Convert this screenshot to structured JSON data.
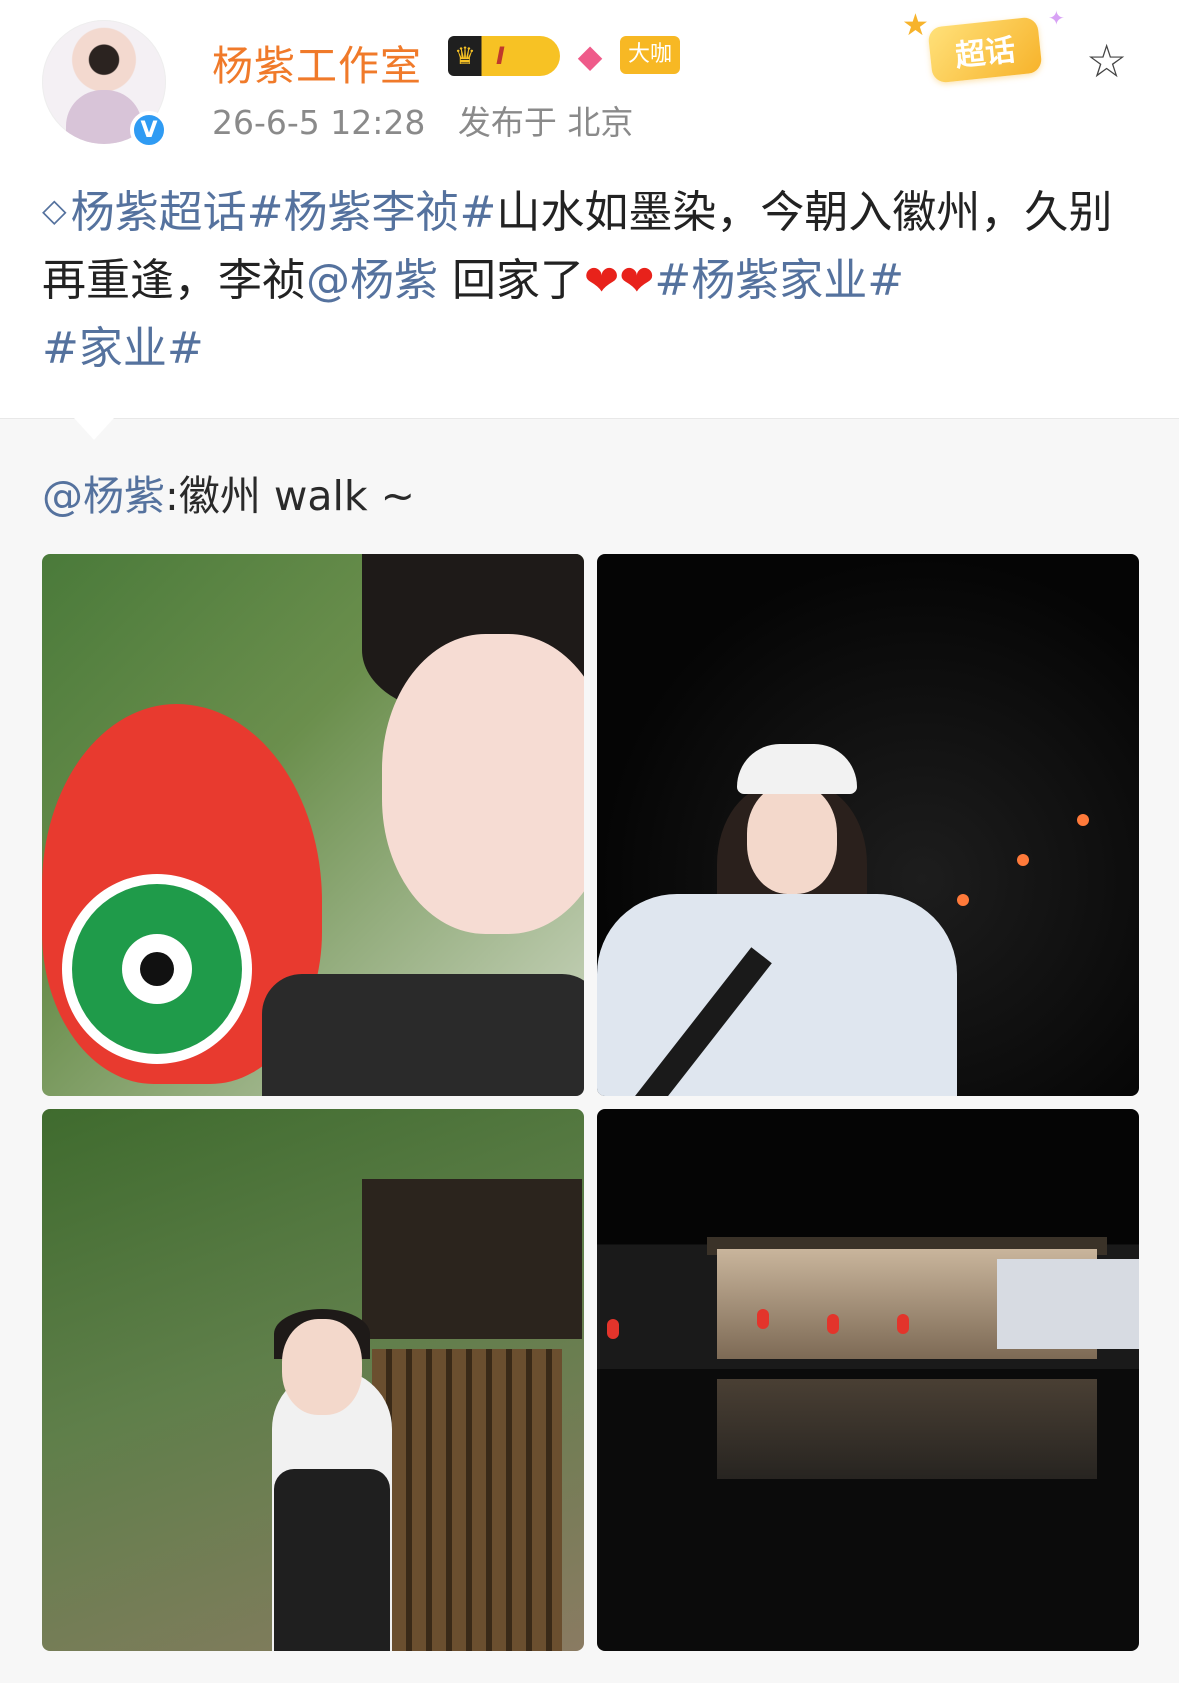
{
  "header": {
    "username": "杨紫工作室",
    "level_badge": "I",
    "daka_badge": "大咖",
    "chaohua_badge": "超话",
    "verified_mark": "V"
  },
  "meta": {
    "timestamp": "26-6-5 12:28",
    "location": "发布于 北京"
  },
  "post": {
    "topic_1": "杨紫超话",
    "topic_2": "#杨紫李祯#",
    "text_1": "山水如墨染，今朝入徽州，久别再重逢，李祯",
    "mention": "@杨紫",
    "text_2": " 回家了",
    "hearts": "❤❤",
    "topic_3": "#杨紫家业#",
    "topic_4": "#家业#"
  },
  "repost": {
    "mention": "@杨紫",
    "text": ":徽州 walk ~"
  },
  "icons": {
    "topic": "diamond-topic-icon",
    "favorite": "star-outline-icon",
    "gem": "gem-icon",
    "crown": "crown-icon"
  },
  "colors": {
    "username": "#f07a2a",
    "link": "#55729e",
    "heart": "#e8221b",
    "verified": "#2f9bf3",
    "badge_gold": "#f7b824"
  }
}
